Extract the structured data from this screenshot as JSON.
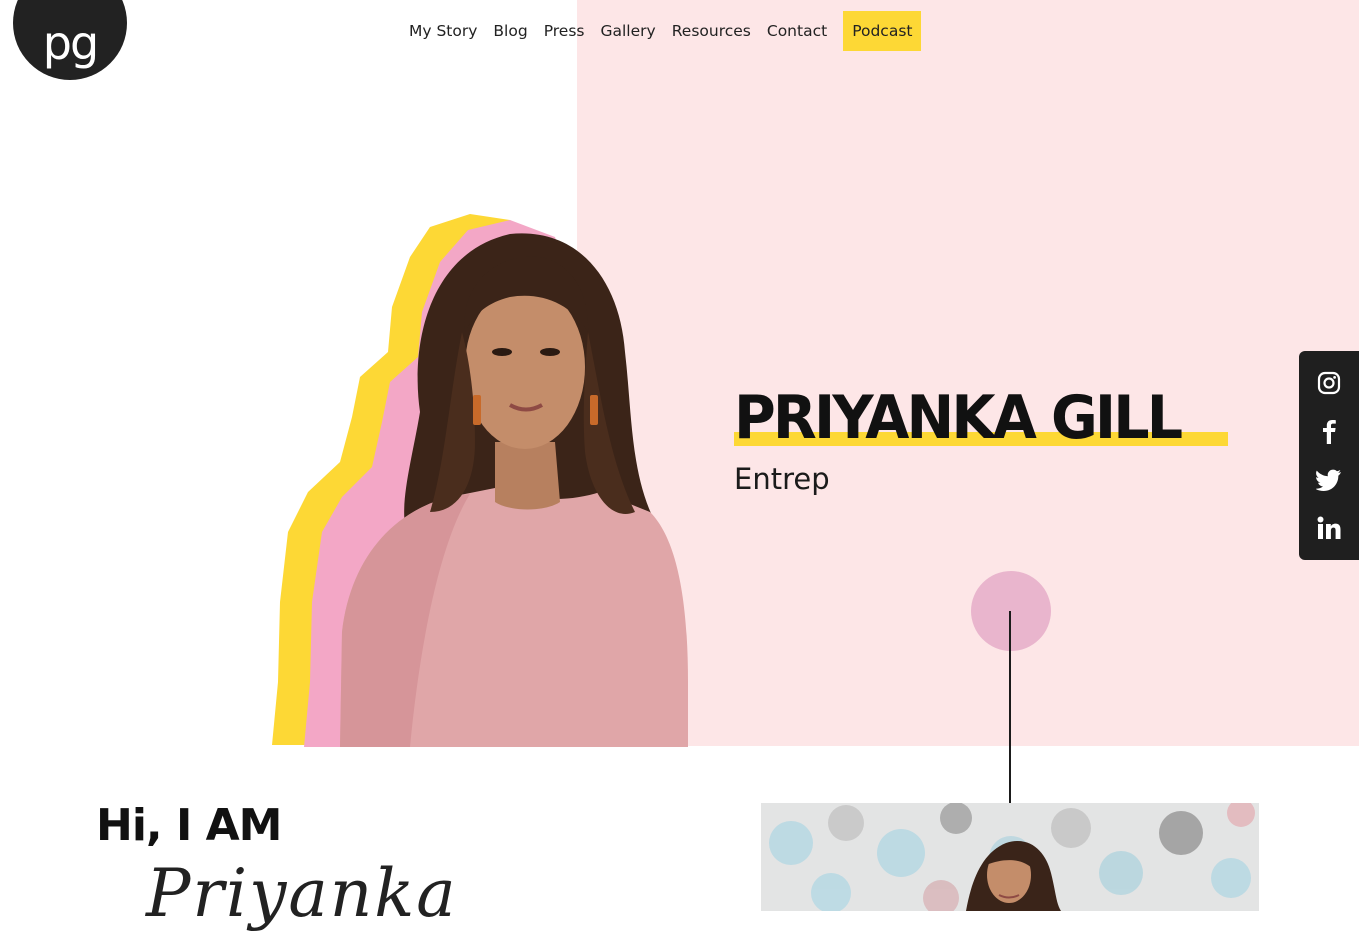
{
  "logo": {
    "text": "pg"
  },
  "nav": {
    "items": [
      {
        "label": "My Story"
      },
      {
        "label": "Blog"
      },
      {
        "label": "Press"
      },
      {
        "label": "Gallery"
      },
      {
        "label": "Resources"
      },
      {
        "label": "Contact"
      }
    ],
    "podcast_label": "Podcast"
  },
  "hero": {
    "name": "PRIYANKA GILL",
    "role": "Entrep"
  },
  "social": {
    "icons": [
      "instagram-icon",
      "facebook-icon",
      "twitter-icon",
      "linkedin-icon"
    ]
  },
  "intro": {
    "title": "Hi, I AM",
    "script_name": "Priyanka"
  },
  "colors": {
    "accent_yellow": "#fdd835",
    "panel_pink": "#fde6e7",
    "photo_pink": "#f3a7c6",
    "circle_pink": "#e9b5cd",
    "dark": "#1f1f1f"
  }
}
